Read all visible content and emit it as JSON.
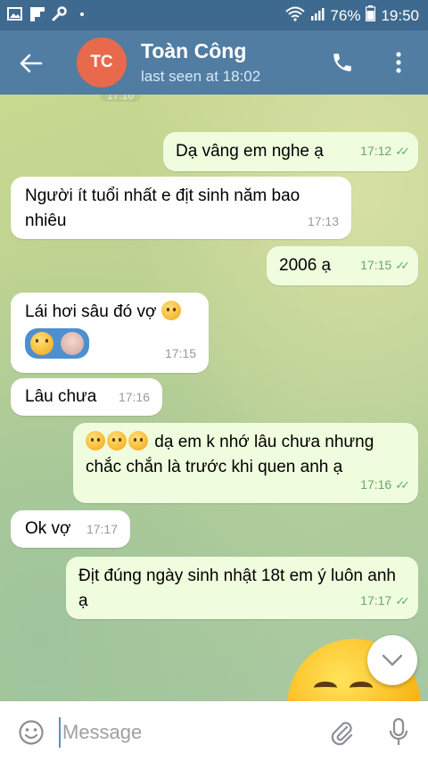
{
  "status_bar": {
    "battery": "76%",
    "time": "19:50",
    "icons": [
      "gallery-icon",
      "flipboard-icon",
      "wrench-icon",
      "dot-icon",
      "wifi-icon",
      "signal-icon",
      "battery-icon"
    ]
  },
  "header": {
    "avatar_initials": "TC",
    "name": "Toàn Công",
    "last_seen": "last seen at 18:02",
    "date_stub": "17:10",
    "colors": {
      "bar": "#517da2",
      "status_bar": "#3f6a8f",
      "avatar": "#e9694d"
    }
  },
  "messages": [
    {
      "dir": "out",
      "text": "Dạ vâng em nghe ạ",
      "time": "17:12"
    },
    {
      "dir": "in",
      "text": "Người ít tuổi nhất e địt sinh năm bao nhiêu",
      "time": "17:13"
    },
    {
      "dir": "out",
      "text": "2006 ạ",
      "time": "17:15"
    },
    {
      "dir": "in",
      "text": "Lái hơi sâu đó vợ",
      "time": "17:15"
    },
    {
      "dir": "in",
      "text": "Lâu chưa",
      "time": "17:16"
    },
    {
      "dir": "out",
      "text": "dạ em k nhớ lâu chưa nhưng chắc chắn là trước khi quen anh ạ",
      "time": "17:16"
    },
    {
      "dir": "in",
      "text": "Ok vợ",
      "time": "17:17"
    },
    {
      "dir": "out",
      "text": "Địt đúng ngày sinh nhật 18t em ý luôn anh ạ",
      "time": "17:17"
    }
  ],
  "input": {
    "placeholder": "Message"
  }
}
